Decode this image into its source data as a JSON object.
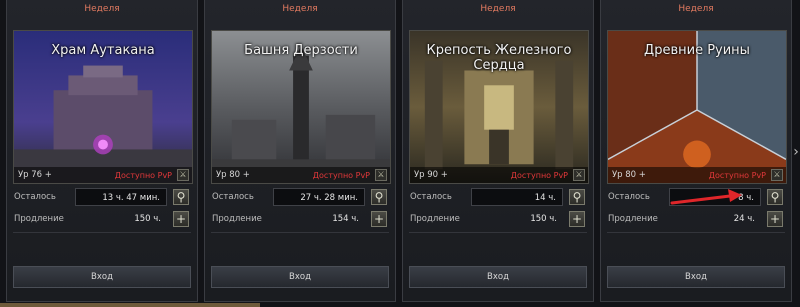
{
  "cards": [
    {
      "period": "Неделя",
      "title": "Храм Аутакана",
      "level": "Ур 76 +",
      "pvp": "Доступно PvP",
      "remaining_label": "Осталось",
      "remaining_value": "13 ч. 47 мин.",
      "extension_label": "Продление",
      "extension_value": "150 ч.",
      "enter_label": "Вход",
      "theme": "#4a3a8a"
    },
    {
      "period": "Неделя",
      "title": "Башня Дерзости",
      "level": "Ур 80 +",
      "pvp": "Доступно PvP",
      "remaining_label": "Осталось",
      "remaining_value": "27 ч. 28 мин.",
      "extension_label": "Продление",
      "extension_value": "154 ч.",
      "enter_label": "Вход",
      "theme": "#6f7277"
    },
    {
      "period": "Неделя",
      "title": "Крепость Железного Сердца",
      "level": "Ур 90 +",
      "pvp": "Доступно PvP",
      "remaining_label": "Осталось",
      "remaining_value": "14 ч.",
      "extension_label": "Продление",
      "extension_value": "150 ч.",
      "enter_label": "Вход",
      "theme": "#7a6a40"
    },
    {
      "period": "Неделя",
      "title": "Древние Руины",
      "level": "Ур 80 +",
      "pvp": "Доступно PvP",
      "remaining_label": "Осталось",
      "remaining_value": "8 ч.",
      "extension_label": "Продление",
      "extension_value": "24 ч.",
      "enter_label": "Вход",
      "theme": "#8a3a20"
    }
  ],
  "colors": {
    "period": "#e27a60",
    "pvp": "#e2383a",
    "arrow_annotation": "#e0262a"
  },
  "icons": {
    "search": "magnifier-icon",
    "extend": "plus-icon",
    "pvp": "pvp-icon",
    "next": "chevron-right-icon"
  }
}
